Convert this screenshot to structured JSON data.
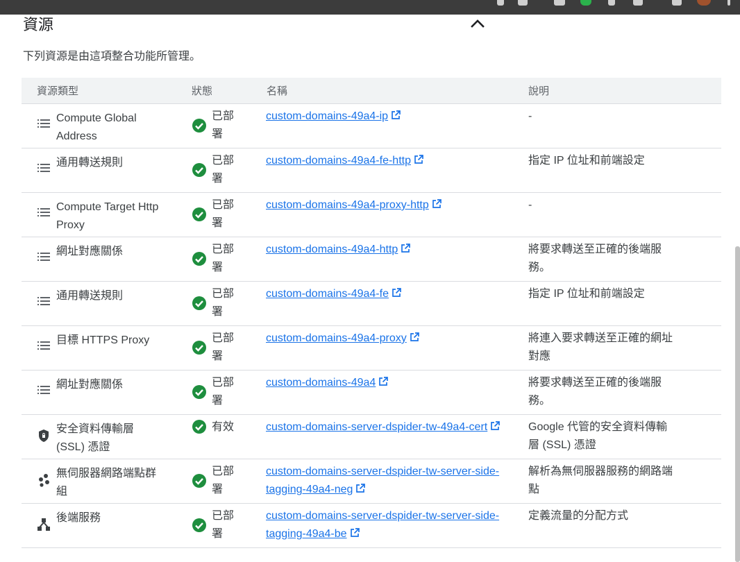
{
  "section": {
    "title": "資源",
    "subtitle": "下列資源是由這項整合功能所管理。"
  },
  "table": {
    "headers": [
      "資源類型",
      "狀態",
      "名稱",
      "說明"
    ],
    "rows": [
      {
        "type": "Compute Global Address",
        "type_icon": "list-icon",
        "status": "已部署",
        "name": "custom-domains-49a4-ip",
        "description": "-"
      },
      {
        "type": "通用轉送規則",
        "type_icon": "list-icon",
        "status": "已部署",
        "name": "custom-domains-49a4-fe-http",
        "description": "指定 IP 位址和前端設定"
      },
      {
        "type": "Compute Target Http Proxy",
        "type_icon": "list-icon",
        "status": "已部署",
        "name": "custom-domains-49a4-proxy-http",
        "description": "-"
      },
      {
        "type": "網址對應關係",
        "type_icon": "list-icon",
        "status": "已部署",
        "name": "custom-domains-49a4-http",
        "description": "將要求轉送至正確的後端服務。"
      },
      {
        "type": "通用轉送規則",
        "type_icon": "list-icon",
        "status": "已部署",
        "name": "custom-domains-49a4-fe",
        "description": "指定 IP 位址和前端設定"
      },
      {
        "type": "目標 HTTPS Proxy",
        "type_icon": "list-icon",
        "status": "已部署",
        "name": "custom-domains-49a4-proxy",
        "description": "將連入要求轉送至正確的網址對應"
      },
      {
        "type": "網址對應關係",
        "type_icon": "list-icon",
        "status": "已部署",
        "name": "custom-domains-49a4",
        "description": "將要求轉送至正確的後端服務。"
      },
      {
        "type": "安全資料傳輸層 (SSL) 憑證",
        "type_icon": "shield-icon",
        "status": "有效",
        "name": "custom-domains-server-dspider-tw-49a4-cert",
        "description": "Google 代管的安全資料傳輸層 (SSL) 憑證"
      },
      {
        "type": "無伺服器網路端點群組",
        "type_icon": "endpoint-group-icon",
        "status": "已部署",
        "name": "custom-domains-server-dspider-tw-server-side-tagging-49a4-neg",
        "description": "解析為無伺服器服務的網路端點"
      },
      {
        "type": "後端服務",
        "type_icon": "backend-service-icon",
        "status": "已部署",
        "name": "custom-domains-server-dspider-tw-server-side-tagging-49a4-be",
        "description": "定義流量的分配方式"
      }
    ]
  },
  "colors": {
    "link": "#1a73e8",
    "status_ok": "#1e8e3e",
    "header_bg": "#f1f3f4",
    "divider": "#dadce0"
  }
}
